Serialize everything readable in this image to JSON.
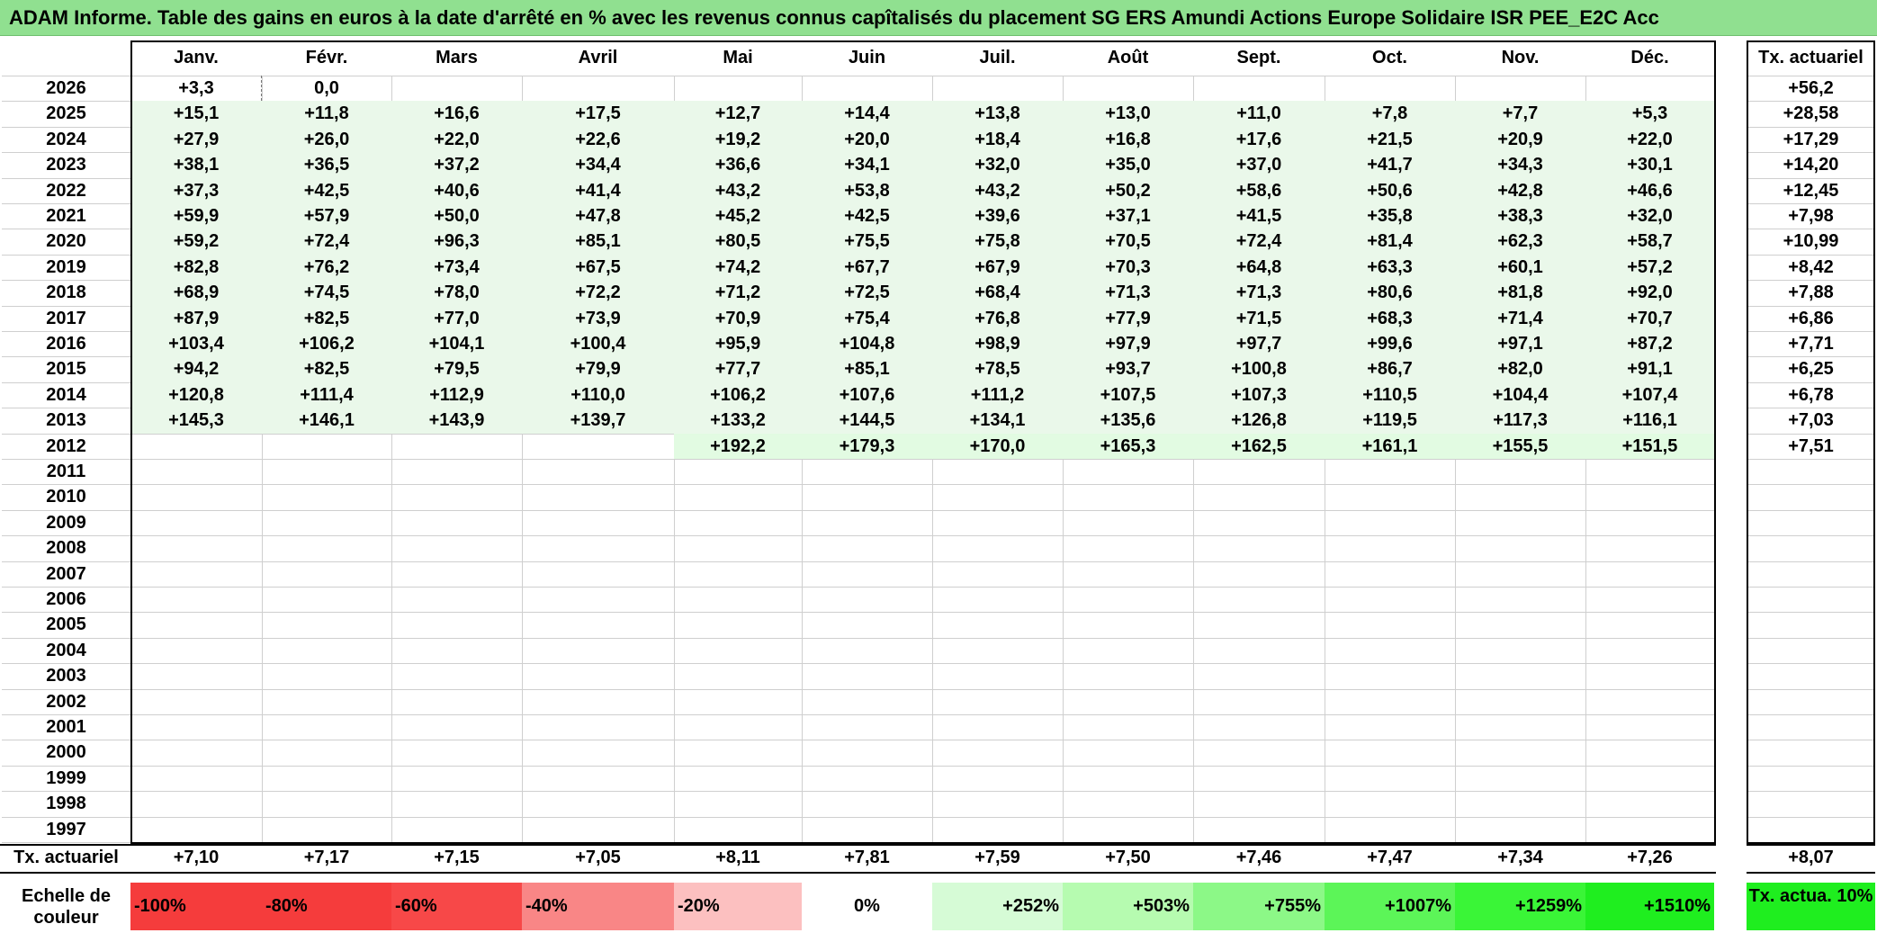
{
  "title": "ADAM Informe. Table des gains en euros à la date d'arrêté en % avec les revenus connus capîtalisés du placement SG ERS Amundi Actions Europe Solidaire ISR PEE_E2C Acc",
  "months": [
    "Janv.",
    "Févr.",
    "Mars",
    "Avril",
    "Mai",
    "Juin",
    "Juil.",
    "Août",
    "Sept.",
    "Oct.",
    "Nov.",
    "Déc."
  ],
  "rate_header": "Tx. actuariel",
  "years": [
    {
      "year": "2026",
      "values": [
        "+3,3",
        "0,0",
        "",
        "",
        "",
        "",
        "",
        "",
        "",
        "",
        "",
        ""
      ],
      "rate": "+56,2"
    },
    {
      "year": "2025",
      "values": [
        "+15,1",
        "+11,8",
        "+16,6",
        "+17,5",
        "+12,7",
        "+14,4",
        "+13,8",
        "+13,0",
        "+11,0",
        "+7,8",
        "+7,7",
        "+5,3"
      ],
      "rate": "+28,58"
    },
    {
      "year": "2024",
      "values": [
        "+27,9",
        "+26,0",
        "+22,0",
        "+22,6",
        "+19,2",
        "+20,0",
        "+18,4",
        "+16,8",
        "+17,6",
        "+21,5",
        "+20,9",
        "+22,0"
      ],
      "rate": "+17,29"
    },
    {
      "year": "2023",
      "values": [
        "+38,1",
        "+36,5",
        "+37,2",
        "+34,4",
        "+36,6",
        "+34,1",
        "+32,0",
        "+35,0",
        "+37,0",
        "+41,7",
        "+34,3",
        "+30,1"
      ],
      "rate": "+14,20"
    },
    {
      "year": "2022",
      "values": [
        "+37,3",
        "+42,5",
        "+40,6",
        "+41,4",
        "+43,2",
        "+53,8",
        "+43,2",
        "+50,2",
        "+58,6",
        "+50,6",
        "+42,8",
        "+46,6"
      ],
      "rate": "+12,45"
    },
    {
      "year": "2021",
      "values": [
        "+59,9",
        "+57,9",
        "+50,0",
        "+47,8",
        "+45,2",
        "+42,5",
        "+39,6",
        "+37,1",
        "+41,5",
        "+35,8",
        "+38,3",
        "+32,0"
      ],
      "rate": "+7,98"
    },
    {
      "year": "2020",
      "values": [
        "+59,2",
        "+72,4",
        "+96,3",
        "+85,1",
        "+80,5",
        "+75,5",
        "+75,8",
        "+70,5",
        "+72,4",
        "+81,4",
        "+62,3",
        "+58,7"
      ],
      "rate": "+10,99"
    },
    {
      "year": "2019",
      "values": [
        "+82,8",
        "+76,2",
        "+73,4",
        "+67,5",
        "+74,2",
        "+67,7",
        "+67,9",
        "+70,3",
        "+64,8",
        "+63,3",
        "+60,1",
        "+57,2"
      ],
      "rate": "+8,42"
    },
    {
      "year": "2018",
      "values": [
        "+68,9",
        "+74,5",
        "+78,0",
        "+72,2",
        "+71,2",
        "+72,5",
        "+68,4",
        "+71,3",
        "+71,3",
        "+80,6",
        "+81,8",
        "+92,0"
      ],
      "rate": "+7,88"
    },
    {
      "year": "2017",
      "values": [
        "+87,9",
        "+82,5",
        "+77,0",
        "+73,9",
        "+70,9",
        "+75,4",
        "+76,8",
        "+77,9",
        "+71,5",
        "+68,3",
        "+71,4",
        "+70,7"
      ],
      "rate": "+6,86"
    },
    {
      "year": "2016",
      "values": [
        "+103,4",
        "+106,2",
        "+104,1",
        "+100,4",
        "+95,9",
        "+104,8",
        "+98,9",
        "+97,9",
        "+97,7",
        "+99,6",
        "+97,1",
        "+87,2"
      ],
      "rate": "+7,71"
    },
    {
      "year": "2015",
      "values": [
        "+94,2",
        "+82,5",
        "+79,5",
        "+79,9",
        "+77,7",
        "+85,1",
        "+78,5",
        "+93,7",
        "+100,8",
        "+86,7",
        "+82,0",
        "+91,1"
      ],
      "rate": "+6,25"
    },
    {
      "year": "2014",
      "values": [
        "+120,8",
        "+111,4",
        "+112,9",
        "+110,0",
        "+106,2",
        "+107,6",
        "+111,2",
        "+107,5",
        "+107,3",
        "+110,5",
        "+104,4",
        "+107,4"
      ],
      "rate": "+6,78"
    },
    {
      "year": "2013",
      "values": [
        "+145,3",
        "+146,1",
        "+143,9",
        "+139,7",
        "+133,2",
        "+144,5",
        "+134,1",
        "+135,6",
        "+126,8",
        "+119,5",
        "+117,3",
        "+116,1"
      ],
      "rate": "+7,03"
    },
    {
      "year": "2012",
      "values": [
        "",
        "",
        "",
        "",
        "+192,2",
        "+179,3",
        "+170,0",
        "+165,3",
        "+162,5",
        "+161,1",
        "+155,5",
        "+151,5"
      ],
      "rate": "+7,51"
    },
    {
      "year": "2011",
      "values": [
        "",
        "",
        "",
        "",
        "",
        "",
        "",
        "",
        "",
        "",
        "",
        ""
      ],
      "rate": ""
    },
    {
      "year": "2010",
      "values": [
        "",
        "",
        "",
        "",
        "",
        "",
        "",
        "",
        "",
        "",
        "",
        ""
      ],
      "rate": ""
    },
    {
      "year": "2009",
      "values": [
        "",
        "",
        "",
        "",
        "",
        "",
        "",
        "",
        "",
        "",
        "",
        ""
      ],
      "rate": ""
    },
    {
      "year": "2008",
      "values": [
        "",
        "",
        "",
        "",
        "",
        "",
        "",
        "",
        "",
        "",
        "",
        ""
      ],
      "rate": ""
    },
    {
      "year": "2007",
      "values": [
        "",
        "",
        "",
        "",
        "",
        "",
        "",
        "",
        "",
        "",
        "",
        ""
      ],
      "rate": ""
    },
    {
      "year": "2006",
      "values": [
        "",
        "",
        "",
        "",
        "",
        "",
        "",
        "",
        "",
        "",
        "",
        ""
      ],
      "rate": ""
    },
    {
      "year": "2005",
      "values": [
        "",
        "",
        "",
        "",
        "",
        "",
        "",
        "",
        "",
        "",
        "",
        ""
      ],
      "rate": ""
    },
    {
      "year": "2004",
      "values": [
        "",
        "",
        "",
        "",
        "",
        "",
        "",
        "",
        "",
        "",
        "",
        ""
      ],
      "rate": ""
    },
    {
      "year": "2003",
      "values": [
        "",
        "",
        "",
        "",
        "",
        "",
        "",
        "",
        "",
        "",
        "",
        ""
      ],
      "rate": ""
    },
    {
      "year": "2002",
      "values": [
        "",
        "",
        "",
        "",
        "",
        "",
        "",
        "",
        "",
        "",
        "",
        ""
      ],
      "rate": ""
    },
    {
      "year": "2001",
      "values": [
        "",
        "",
        "",
        "",
        "",
        "",
        "",
        "",
        "",
        "",
        "",
        ""
      ],
      "rate": ""
    },
    {
      "year": "2000",
      "values": [
        "",
        "",
        "",
        "",
        "",
        "",
        "",
        "",
        "",
        "",
        "",
        ""
      ],
      "rate": ""
    },
    {
      "year": "1999",
      "values": [
        "",
        "",
        "",
        "",
        "",
        "",
        "",
        "",
        "",
        "",
        "",
        ""
      ],
      "rate": ""
    },
    {
      "year": "1998",
      "values": [
        "",
        "",
        "",
        "",
        "",
        "",
        "",
        "",
        "",
        "",
        "",
        ""
      ],
      "rate": ""
    },
    {
      "year": "1997",
      "values": [
        "",
        "",
        "",
        "",
        "",
        "",
        "",
        "",
        "",
        "",
        "",
        ""
      ],
      "rate": ""
    }
  ],
  "footer": {
    "label": "Tx. actuariel",
    "values": [
      "+7,10",
      "+7,17",
      "+7,15",
      "+7,05",
      "+8,11",
      "+7,81",
      "+7,59",
      "+7,50",
      "+7,46",
      "+7,47",
      "+7,34",
      "+7,26"
    ],
    "total": "+8,07"
  },
  "scale": {
    "label": "Echelle de couleur",
    "steps": [
      {
        "label": "-100%",
        "color": "#f53c3c",
        "align": "left"
      },
      {
        "label": "-80%",
        "color": "#f53c3c",
        "align": "left"
      },
      {
        "label": "-60%",
        "color": "#f74848",
        "align": "left"
      },
      {
        "label": "-40%",
        "color": "#f98686",
        "align": "left"
      },
      {
        "label": "-20%",
        "color": "#fcc0c0",
        "align": "left"
      },
      {
        "label": "0%",
        "color": "#ffffff",
        "align": "center"
      },
      {
        "label": "+252%",
        "color": "#d6fbd6",
        "align": "right"
      },
      {
        "label": "+503%",
        "color": "#b6fbb0",
        "align": "right"
      },
      {
        "label": "+755%",
        "color": "#8cf887",
        "align": "right"
      },
      {
        "label": "+1007%",
        "color": "#5cf558",
        "align": "right"
      },
      {
        "label": "+1259%",
        "color": "#3af537",
        "align": "right"
      },
      {
        "label": "+1510%",
        "color": "#1fee1f",
        "align": "right"
      }
    ],
    "legend": "Tx. actua. 10%",
    "legend_color": "#1fee1f"
  },
  "colors": {
    "title_bg": "#90e090",
    "tint_light": "#eaf8ea",
    "tint_green": "#e2fbe2"
  }
}
